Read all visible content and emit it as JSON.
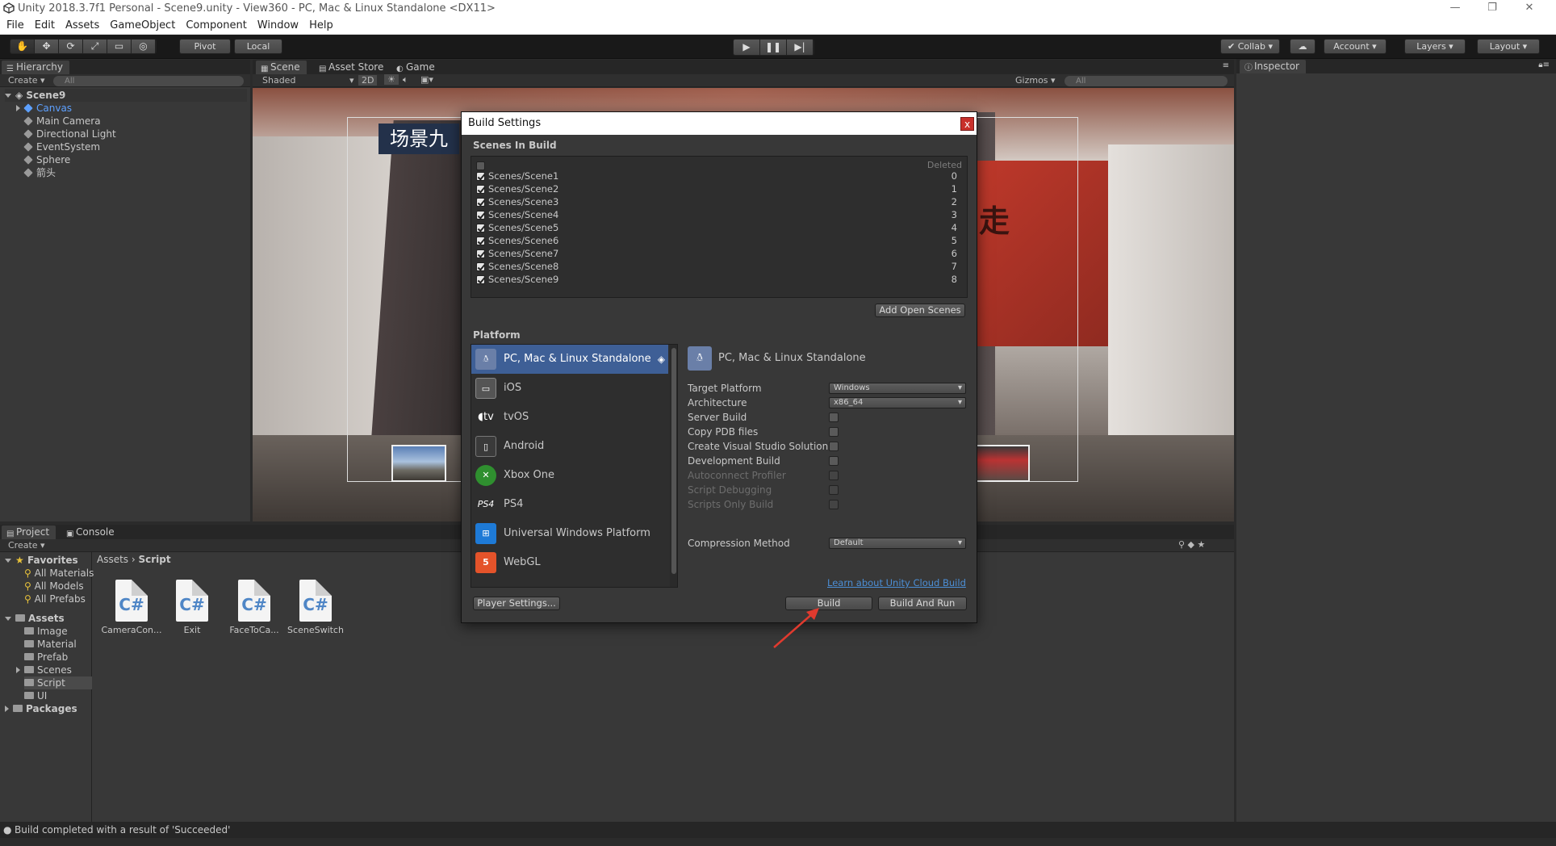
{
  "window": {
    "title": "Unity 2018.3.7f1 Personal - Scene9.unity - View360 - PC, Mac & Linux Standalone <DX11>",
    "minimize": "—",
    "maximize": "❐",
    "close": "✕"
  },
  "menu": [
    "File",
    "Edit",
    "Assets",
    "GameObject",
    "Component",
    "Window",
    "Help"
  ],
  "toolbar": {
    "pivot": "Pivot",
    "local": "Local",
    "collab": "Collab",
    "account": "Account",
    "layers": "Layers",
    "layout": "Layout"
  },
  "hierarchy": {
    "tab": "Hierarchy",
    "create": "Create",
    "search_placeholder": "All",
    "scene": "Scene9",
    "items": [
      "Canvas",
      "Main Camera",
      "Directional Light",
      "EventSystem",
      "Sphere",
      "箭头"
    ]
  },
  "scene_tabs": [
    "Scene",
    "Asset Store",
    "Game"
  ],
  "scene_bar": {
    "shading": "Shaded",
    "mode_2d": "2D",
    "gizmos": "Gizmos",
    "search_placeholder": "All"
  },
  "scene_content": {
    "title_text": "场景九",
    "sign_text": "走"
  },
  "inspector": {
    "tab": "Inspector"
  },
  "build_settings": {
    "title": "Build Settings",
    "close": "x",
    "scenes_label": "Scenes In Build",
    "deleted_label": "Deleted",
    "scenes": [
      {
        "name": "Scenes/Scene1",
        "index": "0"
      },
      {
        "name": "Scenes/Scene2",
        "index": "1"
      },
      {
        "name": "Scenes/Scene3",
        "index": "2"
      },
      {
        "name": "Scenes/Scene4",
        "index": "3"
      },
      {
        "name": "Scenes/Scene5",
        "index": "4"
      },
      {
        "name": "Scenes/Scene6",
        "index": "5"
      },
      {
        "name": "Scenes/Scene7",
        "index": "6"
      },
      {
        "name": "Scenes/Scene8",
        "index": "7"
      },
      {
        "name": "Scenes/Scene9",
        "index": "8"
      }
    ],
    "add_open_scenes": "Add Open Scenes",
    "platform_label": "Platform",
    "platforms": [
      {
        "name": "PC, Mac & Linux Standalone",
        "icon": "pc-icon",
        "selected": true
      },
      {
        "name": "iOS",
        "icon": "ios-icon",
        "selected": false
      },
      {
        "name": "tvOS",
        "icon": "tvos-icon",
        "selected": false
      },
      {
        "name": "Android",
        "icon": "android-icon",
        "selected": false
      },
      {
        "name": "Xbox One",
        "icon": "xbox-icon",
        "selected": false
      },
      {
        "name": "PS4",
        "icon": "ps4-icon",
        "selected": false
      },
      {
        "name": "Universal Windows Platform",
        "icon": "windows-icon",
        "selected": false
      },
      {
        "name": "WebGL",
        "icon": "html5-icon",
        "selected": false
      }
    ],
    "selected_platform_header": "PC, Mac & Linux Standalone",
    "options": [
      {
        "label": "Target Platform",
        "kind": "dropdown",
        "value": "Windows",
        "enabled": true
      },
      {
        "label": "Architecture",
        "kind": "dropdown",
        "value": "x86_64",
        "enabled": true
      },
      {
        "label": "Server Build",
        "kind": "checkbox",
        "enabled": true
      },
      {
        "label": "Copy PDB files",
        "kind": "checkbox",
        "enabled": true
      },
      {
        "label": "Create Visual Studio Solution",
        "kind": "checkbox",
        "enabled": true
      },
      {
        "label": "Development Build",
        "kind": "checkbox",
        "enabled": true
      },
      {
        "label": "Autoconnect Profiler",
        "kind": "checkbox",
        "enabled": false
      },
      {
        "label": "Script Debugging",
        "kind": "checkbox",
        "enabled": false
      },
      {
        "label": "Scripts Only Build",
        "kind": "checkbox",
        "enabled": false
      }
    ],
    "compression_label": "Compression Method",
    "compression_value": "Default",
    "cloud_link": "Learn about Unity Cloud Build",
    "player_settings": "Player Settings...",
    "build": "Build",
    "build_and_run": "Build And Run"
  },
  "project": {
    "tabs": [
      "Project",
      "Console"
    ],
    "create": "Create",
    "favorites_label": "Favorites",
    "favorites": [
      "All Materials",
      "All Models",
      "All Prefabs"
    ],
    "assets_label": "Assets",
    "folders": [
      "Image",
      "Material",
      "Prefab",
      "Scenes",
      "Script",
      "UI"
    ],
    "packages_label": "Packages",
    "breadcrumb": [
      "Assets",
      "Script"
    ],
    "files": [
      {
        "name": "CameraCon...",
        "icon_text": "C#"
      },
      {
        "name": "Exit",
        "icon_text": "C#"
      },
      {
        "name": "FaceToCa...",
        "icon_text": "C#"
      },
      {
        "name": "SceneSwitch",
        "icon_text": "C#"
      }
    ]
  },
  "status": {
    "message": "Build completed with a result of 'Succeeded'"
  }
}
